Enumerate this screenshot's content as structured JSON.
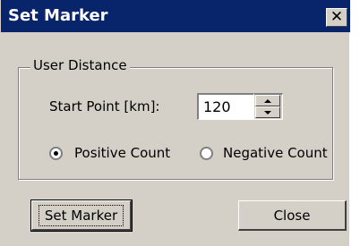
{
  "window": {
    "title": "Set Marker",
    "close_glyph": "✕"
  },
  "group": {
    "legend": "User Distance"
  },
  "start_point": {
    "label": "Start Point [km]:",
    "value": "120"
  },
  "count_mode": {
    "options": [
      {
        "label": "Positive Count",
        "selected": true
      },
      {
        "label": "Negative Count",
        "selected": false
      }
    ]
  },
  "buttons": {
    "set_marker": "Set Marker",
    "close": "Close"
  },
  "colors": {
    "titlebar": "#08246b",
    "face": "#d4d0c8"
  }
}
